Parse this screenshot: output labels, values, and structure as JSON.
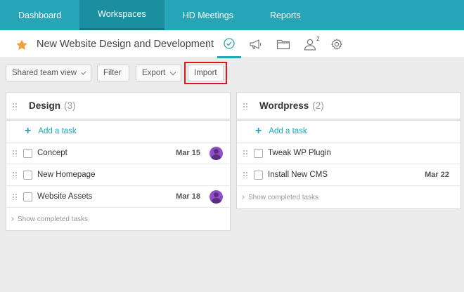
{
  "nav": {
    "items": [
      {
        "label": "Dashboard"
      },
      {
        "label": "Workspaces"
      },
      {
        "label": "HD Meetings"
      },
      {
        "label": "Reports"
      }
    ]
  },
  "project": {
    "title": "New Website Design and Development",
    "members_badge": "2"
  },
  "toolbar": {
    "view_label": "Shared team view",
    "filter_label": "Filter",
    "export_label": "Export",
    "import_label": "Import"
  },
  "lists": [
    {
      "name": "Design",
      "count": "(3)",
      "add_label": "Add a task",
      "tasks": [
        {
          "name": "Concept",
          "date": "Mar 15"
        },
        {
          "name": "New Homepage",
          "date": ""
        },
        {
          "name": "Website Assets",
          "date": "Mar 18"
        }
      ],
      "show_completed": "Show completed tasks"
    },
    {
      "name": "Wordpress",
      "count": "(2)",
      "add_label": "Add a task",
      "tasks": [
        {
          "name": "Tweak WP Plugin",
          "date": ""
        },
        {
          "name": "Install New CMS",
          "date": "Mar 22"
        }
      ],
      "show_completed": "Show completed tasks"
    }
  ],
  "colors": {
    "nav_bg": "#26a4b8",
    "accent": "#26a4b8",
    "star": "#f0a038",
    "highlight": "#e0161c"
  }
}
